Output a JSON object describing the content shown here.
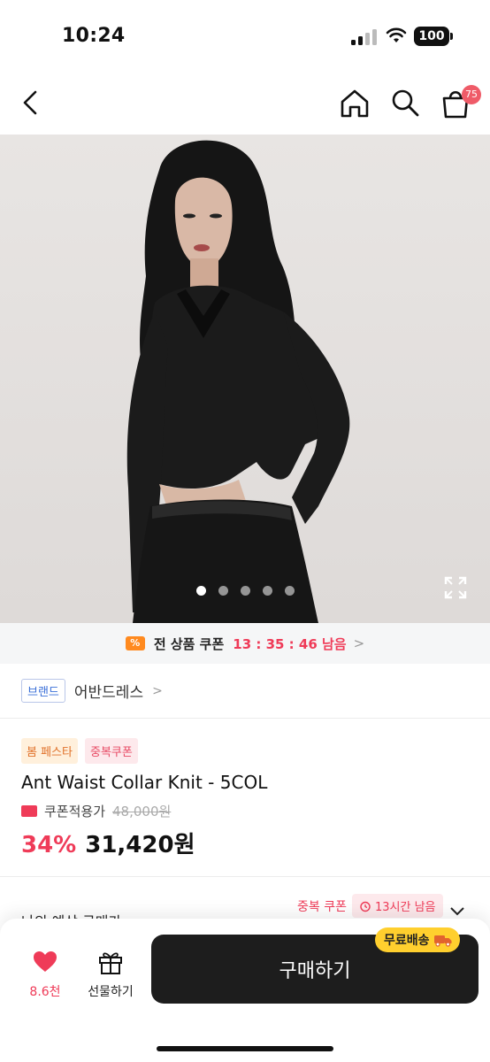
{
  "status_bar": {
    "time": "10:24",
    "battery": "100"
  },
  "nav": {
    "cart_count": "75"
  },
  "gallery": {
    "dots": 5,
    "active_index": 0
  },
  "coupon_bar": {
    "label": "전 상품 쿠폰",
    "timer": "13 : 35 : 46 남음",
    "chevron": ">"
  },
  "brand": {
    "tag": "브랜드",
    "name": "어반드레스",
    "chevron": ">"
  },
  "product": {
    "tags": [
      "봄 페스타",
      "중복쿠폰"
    ],
    "title": "Ant Waist Collar Knit - 5COL",
    "price_label": "쿠폰적용가",
    "original_price": "48,000원",
    "discount": "34%",
    "final_price": "31,420원"
  },
  "peek": {
    "title": "나의 예상 구매가",
    "dup_coupon": "중복 쿠폰",
    "time_left": "13시간 남음"
  },
  "bottom_bar": {
    "like_count": "8.6천",
    "gift_label": "선물하기",
    "buy_label": "구매하기",
    "free_shipping": "무료배송"
  },
  "colors": {
    "accent_red": "#ef3b58",
    "buy_button": "#1d1d1d",
    "free_ship": "#ffcf2e"
  }
}
